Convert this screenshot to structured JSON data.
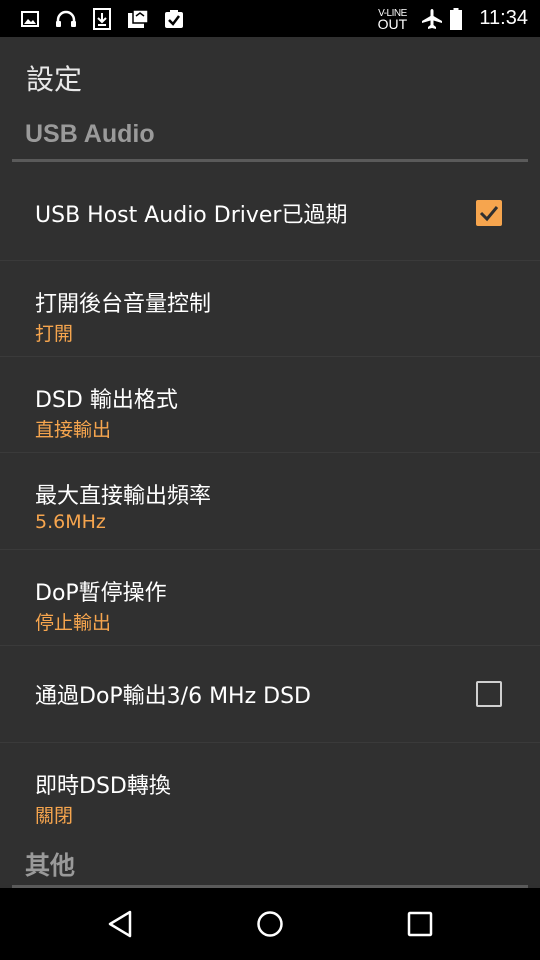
{
  "status_bar": {
    "icons_left": [
      "image-icon",
      "headphones-icon",
      "download-icon",
      "clipboard-icon",
      "task-check-icon"
    ],
    "vline_top": "V-LINE",
    "vline_bottom": "OUT",
    "icons_right": [
      "airplane-icon",
      "battery-icon"
    ],
    "time": "11:34"
  },
  "page_title": "設定",
  "sections": {
    "usb_audio": "USB Audio",
    "other": "其他"
  },
  "prefs": {
    "driver_expired": {
      "title": "USB Host Audio Driver已過期",
      "checked": true
    },
    "background_volume": {
      "title": "打開後台音量控制",
      "summary": "打開"
    },
    "dsd_output_format": {
      "title": "DSD 輸出格式",
      "summary": "直接輸出"
    },
    "max_direct_rate": {
      "title": "最大直接輸出頻率",
      "summary": "5.6MHz"
    },
    "dop_pause": {
      "title": "DoP暫停操作",
      "summary": "停止輸出"
    },
    "dop_3_6": {
      "title": "通過DoP輸出3/6 MHz DSD",
      "checked": false
    },
    "realtime_dsd": {
      "title": "即時DSD轉換",
      "summary": "關閉"
    }
  },
  "nav_bar": [
    "back-icon",
    "home-icon",
    "recents-icon"
  ],
  "colors": {
    "accent": "#f6a54e",
    "background": "#303030",
    "bar": "#000000"
  }
}
